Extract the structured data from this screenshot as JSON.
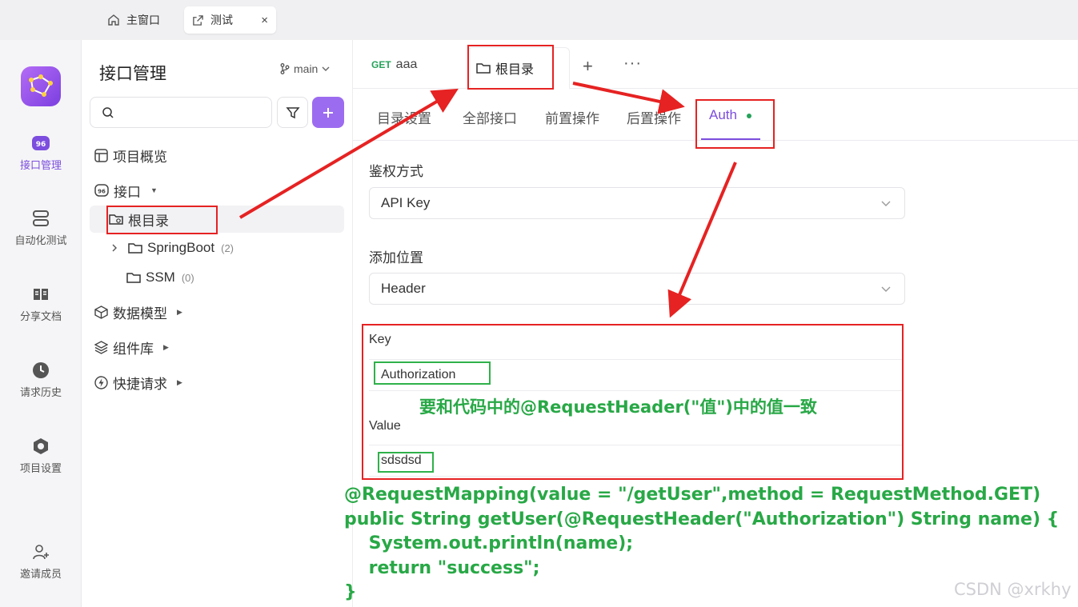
{
  "window_tabs": {
    "home_label": "主窗口",
    "active_label": "测试",
    "close_glyph": "×"
  },
  "rail": {
    "items": [
      {
        "label": "接口管理",
        "icon": "api-icon"
      },
      {
        "label": "自动化测试",
        "icon": "automation-icon"
      },
      {
        "label": "分享文档",
        "icon": "book-icon"
      },
      {
        "label": "请求历史",
        "icon": "clock-icon"
      },
      {
        "label": "项目设置",
        "icon": "settings-icon"
      },
      {
        "label": "邀请成员",
        "icon": "add-user-icon"
      }
    ],
    "accent": "#7c4dde"
  },
  "tree": {
    "title": "接口管理",
    "branch": "main",
    "nodes": {
      "overview": "项目概览",
      "api": "接口",
      "root": "根目录",
      "springboot": {
        "label": "SpringBoot",
        "count": "(2)"
      },
      "ssm": {
        "label": "SSM",
        "count": "(0)"
      },
      "models": "数据模型",
      "components": "组件库",
      "quick": "快捷请求"
    }
  },
  "doc_tabs": {
    "get_method": "GET",
    "get_name": "aaa",
    "root_label": "根目录",
    "plus": "+",
    "more": "···"
  },
  "sub_tabs": {
    "items": [
      "目录设置",
      "全部接口",
      "前置操作",
      "后置操作",
      "Auth"
    ]
  },
  "auth": {
    "method_label": "鉴权方式",
    "method_value": "API Key",
    "location_label": "添加位置",
    "location_value": "Header",
    "key_label": "Key",
    "key_value": "Authorization",
    "value_label": "Value",
    "value_value": "sdsdsd"
  },
  "annotations": {
    "note": "要和代码中的@RequestHeader(\"值\")中的值一致",
    "code_lines": [
      "@RequestMapping(value = \"/getUser\",method = RequestMethod.GET)",
      "public String getUser(@RequestHeader(\"Authorization\") String name) {",
      "    System.out.println(name);",
      "    return \"success\";",
      "}"
    ],
    "red": "#e62222",
    "green": "#28a846"
  },
  "watermark": "CSDN @xrkhy"
}
